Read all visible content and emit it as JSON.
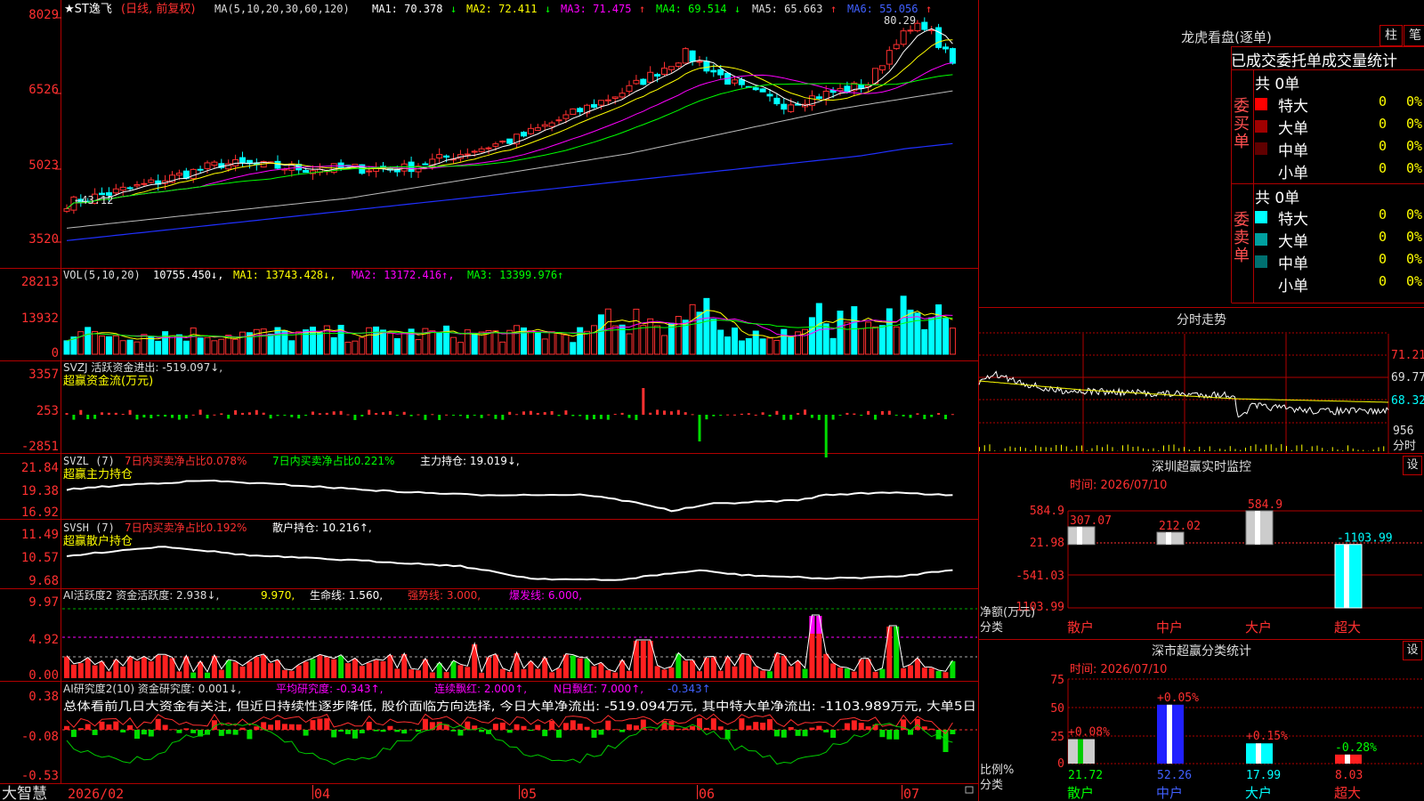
{
  "main": {
    "title_prefix": "★ST逸飞",
    "title_mode": "(日线, 前复权)",
    "ma_spec": "MA(5,10,20,30,60,120)",
    "ma_labels": [
      {
        "label": "MA1: 70.378",
        "arrow": "↓",
        "color": "#ffffff"
      },
      {
        "label": "MA2: 72.411",
        "arrow": "↓",
        "color": "#ffff00"
      },
      {
        "label": "MA3: 71.475",
        "arrow": "↑",
        "color": "#ff00ff"
      },
      {
        "label": "MA4: 69.514",
        "arrow": "↓",
        "color": "#00ff00"
      },
      {
        "label": "MA5: 65.663",
        "arrow": "↑",
        "color": "#bbbbbb"
      },
      {
        "label": "MA6: 55.056",
        "arrow": "↑",
        "color": "#3333ff"
      }
    ],
    "y_ticks": [
      "8029",
      "6526",
      "5023",
      "3520"
    ],
    "high_note": "80.29",
    "low_note": "←43.12"
  },
  "vol": {
    "title": "VOL(5,10,20)",
    "value": "10755.450↓,",
    "ma_labels": [
      {
        "label": "MA1: 13743.428↓,",
        "color": "#ffff00"
      },
      {
        "label": "MA2: 13172.416↑,",
        "color": "#ff00ff"
      },
      {
        "label": "MA3: 13399.976↑",
        "color": "#00ff00"
      }
    ],
    "y_ticks": [
      "28213",
      "13932",
      "0"
    ]
  },
  "svzj": {
    "title": "SVZJ  活跃资金进出: -519.097↓,",
    "subtitle": "超赢资金流(万元)",
    "y_ticks": [
      "3357",
      "253",
      "-2851"
    ]
  },
  "svzl": {
    "title_a": "SVZL (7)",
    "title_b": "7日内买卖净占比0.078%",
    "title_c": "7日内买卖净占比0.221%",
    "title_d": "主力持仓: 19.019↓,",
    "subtitle": "超赢主力持仓",
    "y_ticks": [
      "21.84",
      "19.38",
      "16.92"
    ]
  },
  "svsh": {
    "title_a": "SVSH (7)",
    "title_b": "7日内买卖净占比0.192%",
    "title_c": "散户持仓: 10.216↑,",
    "subtitle": "超赢散户持仓",
    "y_ticks": [
      "11.49",
      "10.57",
      "9.68"
    ]
  },
  "ai1": {
    "title_a": "AI活跃度2 资金活跃度: 2.938↓,",
    "title_b": "9.970,",
    "title_c": "生命线: 1.560,",
    "title_d": "强势线: 3.000,",
    "title_e": "爆发线: 6.000,",
    "y_ticks": [
      "9.97",
      "4.92",
      "0.00"
    ]
  },
  "ai2": {
    "title_a": "AI研究度2(10) 资金研究度: 0.001↓,",
    "title_b": "平均研究度: -0.343↑,",
    "title_c": "连续飘红: 2.000↑,",
    "title_d": "N日飘红: 7.000↑,",
    "title_e": "-0.343↑",
    "summary": "总体看前几日大资金有关注, 但近日持续性逐步降低, 股价面临方向选择, 今日大单净流出: -519.094万元, 其中特大单净流出: -1103.989万元, 大单5日",
    "y_ticks": [
      "0.38",
      "-0.08",
      "-0.53"
    ]
  },
  "xaxis": {
    "brand": "大智慧",
    "labels": [
      "2026/02",
      "04",
      "05",
      "06",
      "07"
    ]
  },
  "longhu": {
    "title": "龙虎看盘(逐单)",
    "btn_bar": "柱",
    "btn_line": "笔",
    "header": "已成交委托单成交量统计",
    "buy_label": "委买单",
    "sell_label": "委卖单",
    "buy_total": "共 0单",
    "sell_total": "共 0单",
    "buy_rows": [
      {
        "name": "特大",
        "count": "0",
        "pct": "0%",
        "color": "#ff0000"
      },
      {
        "name": "大单",
        "count": "0",
        "pct": "0%",
        "color": "#a00000"
      },
      {
        "name": "中单",
        "count": "0",
        "pct": "0%",
        "color": "#600000"
      },
      {
        "name": "小单",
        "count": "0",
        "pct": "0%",
        "color": "#000000"
      }
    ],
    "sell_rows": [
      {
        "name": "特大",
        "count": "0",
        "pct": "0%",
        "color": "#00ffff"
      },
      {
        "name": "大单",
        "count": "0",
        "pct": "0%",
        "color": "#00a0a0"
      },
      {
        "name": "中单",
        "count": "0",
        "pct": "0%",
        "color": "#007070"
      },
      {
        "name": "小单",
        "count": "0",
        "pct": "0%",
        "color": "#000000"
      }
    ]
  },
  "intraday": {
    "title": "分时走势",
    "y_ticks": [
      "71.21",
      "69.77",
      "68.32"
    ],
    "vol_tick": "956",
    "vol_label": "分时"
  },
  "sz_monitor": {
    "title": "深圳超赢实时监控",
    "set_label": "设",
    "time_label": "时间: 2026/07/10",
    "y_ticks": [
      "584.9",
      "21.98",
      "-541.03",
      "-1103.99"
    ],
    "ylabel_a": "净额(万元)",
    "ylabel_b": "分类"
  },
  "sz_stats": {
    "title": "深市超赢分类统计",
    "set_label": "设",
    "time_label": "时间: 2026/07/10",
    "y_ticks": [
      "75",
      "50",
      "25",
      "0"
    ],
    "ylabel_a": "比例%",
    "ylabel_b": "分类"
  },
  "chart_data": [
    {
      "type": "bar",
      "title": "深圳超赢实时监控",
      "categories": [
        "散户",
        "中户",
        "大户",
        "超大"
      ],
      "values": [
        307.07,
        212.02,
        584.9,
        -1103.99
      ],
      "ylim": [
        -1103.99,
        584.9
      ],
      "ylabel": "净额(万元)"
    },
    {
      "type": "bar",
      "title": "深市超赢分类统计",
      "categories": [
        "散户",
        "中户",
        "大户",
        "超大"
      ],
      "values": [
        21.72,
        52.26,
        17.99,
        8.03
      ],
      "changes": [
        "+0.08%",
        "+0.05%",
        "+0.15%",
        "-0.28%"
      ],
      "ylim": [
        0,
        75
      ],
      "ylabel": "比例%"
    },
    {
      "type": "line",
      "title": "★ST逸飞 (日线, 前复权)",
      "x": [
        "2026/02",
        "04",
        "05",
        "06",
        "07"
      ],
      "y_range": [
        35.2,
        80.29
      ],
      "series": [
        {
          "name": "MA1",
          "values": [
            42,
            44,
            48,
            52,
            49,
            50,
            51,
            53,
            57,
            63,
            70,
            73,
            68,
            65,
            63,
            66,
            75,
            73,
            71,
            70
          ]
        },
        {
          "name": "MA6",
          "values": [
            35.5,
            36.5,
            37.5,
            38.5,
            39.5,
            40.5,
            41.5,
            42.5,
            43.5,
            44.5,
            45.5,
            46.5,
            47.5,
            48.5,
            49.5,
            50.5,
            51.5,
            52.5,
            54,
            55
          ]
        }
      ]
    }
  ]
}
